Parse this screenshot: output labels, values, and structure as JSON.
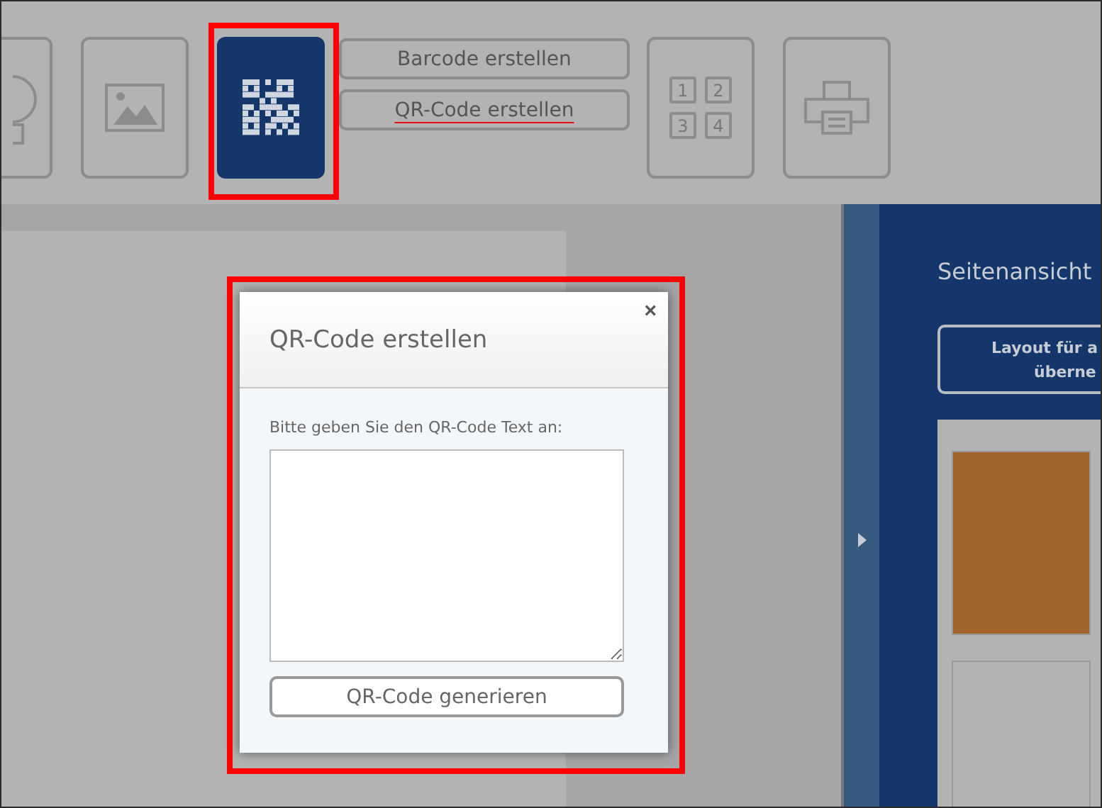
{
  "toolbar": {
    "tiles": [
      {
        "kind": "shape",
        "selected": false
      },
      {
        "kind": "image",
        "selected": false
      },
      {
        "kind": "qr",
        "selected": true,
        "highlighted": true
      },
      {
        "kind": "buttons",
        "buttons": [
          {
            "label": "Barcode erstellen",
            "underlined": false
          },
          {
            "label": "QR-Code erstellen",
            "underlined": true
          }
        ]
      },
      {
        "kind": "numbers",
        "numbers": [
          "1",
          "2",
          "3",
          "4"
        ],
        "selected": false
      },
      {
        "kind": "print",
        "selected": false
      }
    ]
  },
  "sidebar": {
    "title": "Seitenansicht",
    "layout_button": [
      "Layout für a",
      "überne"
    ],
    "thumbnails": [
      {
        "color": "#a0652a"
      },
      {
        "color": "#b4b4b4"
      }
    ]
  },
  "dialog": {
    "title": "QR-Code erstellen",
    "close": "×",
    "label": "Bitte geben Sie den QR-Code Text an:",
    "button": "QR-Code generieren",
    "highlighted": true
  }
}
